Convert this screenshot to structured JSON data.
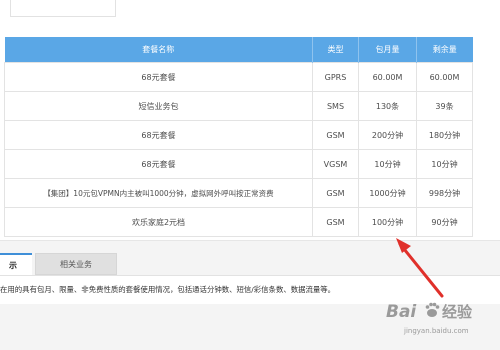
{
  "table": {
    "headers": [
      "套餐名称",
      "类型",
      "包月量",
      "剩余量"
    ],
    "rows": [
      [
        "68元套餐",
        "GPRS",
        "60.00M",
        "60.00M"
      ],
      [
        "短信业务包",
        "SMS",
        "130条",
        "39条"
      ],
      [
        "68元套餐",
        "GSM",
        "200分钟",
        "180分钟"
      ],
      [
        "68元套餐",
        "VGSM",
        "10分钟",
        "10分钟"
      ],
      [
        "【集团】10元包VPMN内主被叫1000分钟，虚拟网外呼叫按正常资费",
        "GSM",
        "1000分钟",
        "998分钟"
      ],
      [
        "欢乐家庭2元档",
        "GSM",
        "100分钟",
        "90分钟"
      ]
    ]
  },
  "tabs": {
    "active_label": "示",
    "other_label": "相关业务"
  },
  "description": "在用的具有包月、限量、非免费性质的套餐使用情况，包括通话分钟数、短信/彩信条数、数据流量等。",
  "watermark": {
    "brand": "Bai",
    "brand_suffix": "经验",
    "url": "jingyan.baidu.com"
  },
  "colors": {
    "header_bg": "#5aa7e6",
    "arrow": "#e0302a",
    "active_tab_accent": "#3f8fd8"
  }
}
